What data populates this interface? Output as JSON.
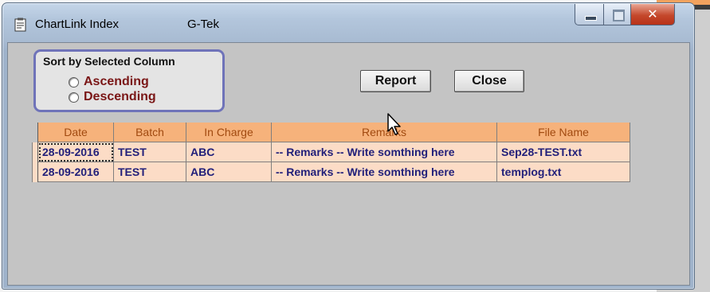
{
  "window": {
    "title": "ChartLink Index",
    "app_name": "G-Tek",
    "controls": {
      "minimize": "minimize-icon",
      "maximize": "maximize-icon",
      "close": "close-icon"
    }
  },
  "sort": {
    "title": "Sort by Selected Column",
    "options": [
      {
        "label": "Ascending",
        "selected": false
      },
      {
        "label": "Descending",
        "selected": false
      }
    ]
  },
  "buttons": {
    "report": "Report",
    "close": "Close"
  },
  "table": {
    "headers": [
      "Date",
      "Batch",
      "In Charge",
      "Remarks",
      "File Name"
    ],
    "rows": [
      [
        "28-09-2016",
        "TEST",
        "ABC",
        "-- Remarks -- Write somthing here",
        "Sep28-TEST.txt"
      ],
      [
        "28-09-2016",
        "TEST",
        "ABC",
        "-- Remarks -- Write somthing here",
        "templog.txt"
      ]
    ]
  },
  "colors": {
    "header_bg": "#f6b27b",
    "header_text": "#a14a10",
    "row_bg": "#fcdcc6",
    "row_text": "#22207a",
    "sort_border": "#6f73b9",
    "radio_label": "#7a1616"
  }
}
